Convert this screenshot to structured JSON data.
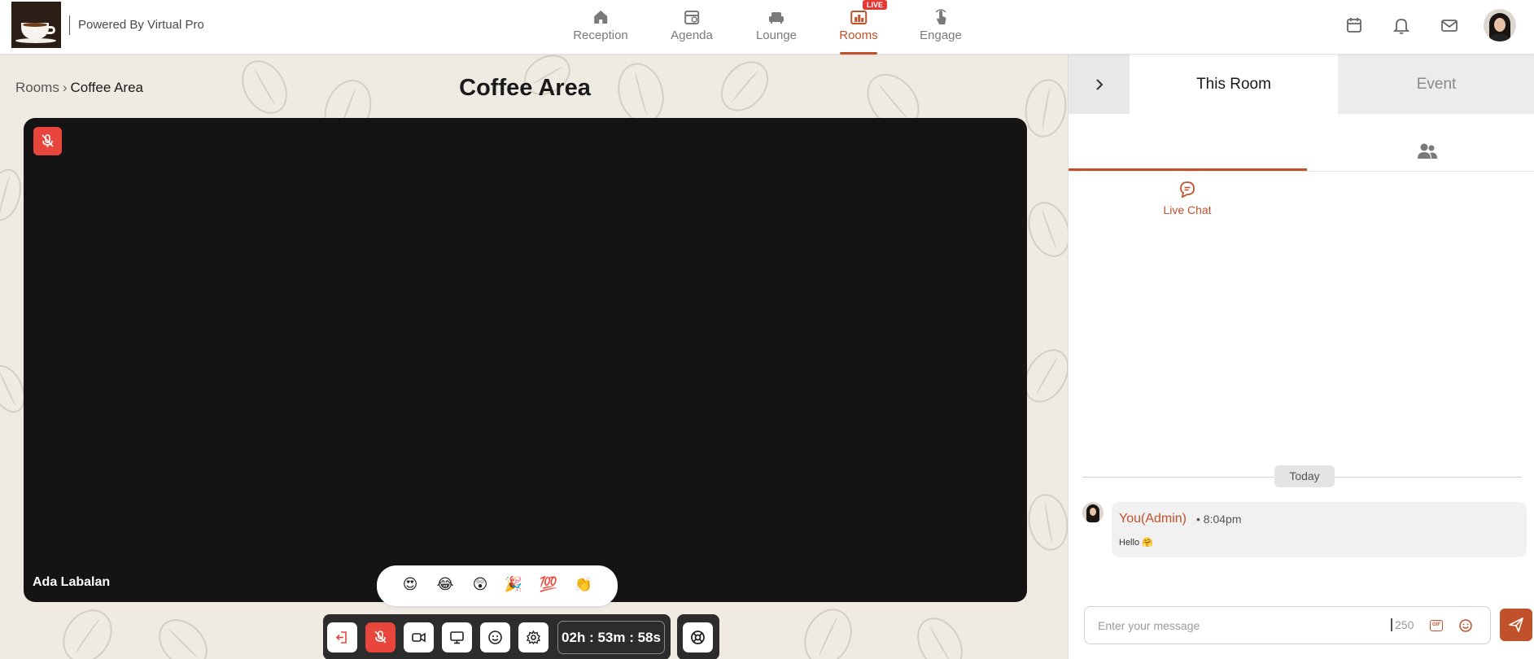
{
  "header": {
    "powered_by": "Powered By Virtual Pro",
    "live_badge": "LIVE",
    "nav": [
      {
        "label": "Reception",
        "icon": "home-icon"
      },
      {
        "label": "Agenda",
        "icon": "agenda-calendar-icon"
      },
      {
        "label": "Lounge",
        "icon": "sofa-icon"
      },
      {
        "label": "Rooms",
        "icon": "rooms-icon",
        "active": true
      },
      {
        "label": "Engage",
        "icon": "hand-tap-icon"
      }
    ],
    "right_icons": [
      "calendar-icon",
      "bell-icon",
      "mail-icon"
    ]
  },
  "main": {
    "breadcrumb": {
      "parent": "Rooms",
      "current": "Coffee Area"
    },
    "title": "Coffee Area",
    "participant_name": "Ada Labalan",
    "reactions": [
      "😍",
      "😂",
      "😲",
      "🎉",
      "💯",
      "👏"
    ],
    "timer": "02h : 53m : 58s"
  },
  "panel": {
    "tabs": {
      "room": "This Room",
      "event": "Event"
    },
    "live_chat_label": "Live Chat",
    "date_divider": "Today",
    "messages": [
      {
        "author": "You(Admin)",
        "time": "• 8:04pm",
        "text": "Hello 🤗"
      }
    ],
    "input_placeholder": "Enter your message",
    "char_limit": "250",
    "gif_label": "GIF"
  },
  "colors": {
    "accent": "#c0512a",
    "live_red": "#e53935",
    "mute_red": "#e8453c",
    "video_bg": "#141414",
    "page_bg": "#efebe3"
  }
}
